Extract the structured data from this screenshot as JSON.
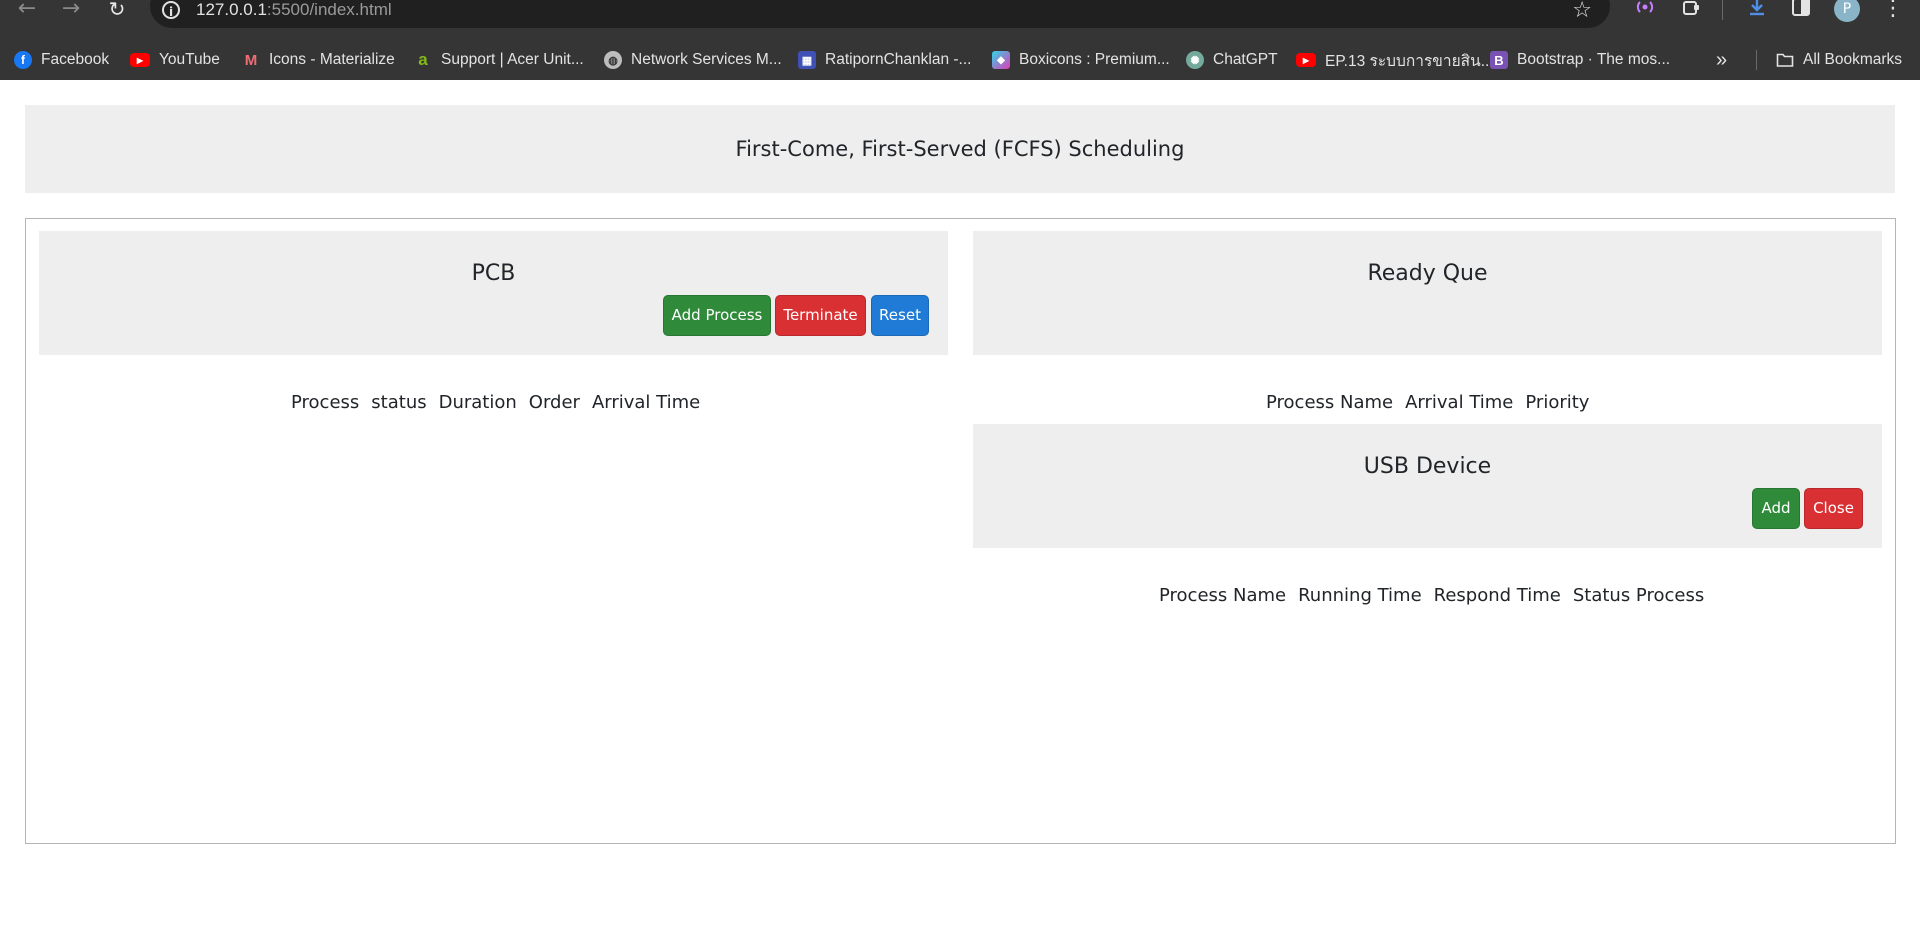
{
  "browser": {
    "url_host": "127.0.0.1",
    "url_rest": ":5500/index.html",
    "profile_initial": "P",
    "bookmarks": [
      {
        "label": "Facebook",
        "icon": "facebook-icon"
      },
      {
        "label": "YouTube",
        "icon": "youtube-icon"
      },
      {
        "label": "Icons - Materialize",
        "icon": "materialize-icon"
      },
      {
        "label": "Support | Acer Unit...",
        "icon": "acer-icon"
      },
      {
        "label": "Network Services M...",
        "icon": "globe-icon"
      },
      {
        "label": "RatipornChanklan -...",
        "icon": "site-icon"
      },
      {
        "label": "Boxicons : Premium...",
        "icon": "boxicons-icon"
      },
      {
        "label": "ChatGPT",
        "icon": "chatgpt-icon"
      },
      {
        "label": "EP.13 ระบบการขายสิน...",
        "icon": "youtube-icon"
      },
      {
        "label": "Bootstrap · The mos...",
        "icon": "bootstrap-icon"
      }
    ],
    "more_bookmarks": "»",
    "all_bookmarks": "All Bookmarks"
  },
  "page": {
    "title": "First-Come, First-Served (FCFS) Scheduling",
    "pcb": {
      "title": "PCB",
      "buttons": {
        "add": "Add Process",
        "terminate": "Terminate",
        "reset": "Reset"
      },
      "columns": [
        "Process",
        "status",
        "Duration",
        "Order",
        "Arrival Time"
      ]
    },
    "ready_queue": {
      "title": "Ready Que",
      "columns": [
        "Process Name",
        "Arrival Time",
        "Priority"
      ]
    },
    "usb": {
      "title": "USB Device",
      "buttons": {
        "add": "Add",
        "close": "Close"
      },
      "columns": [
        "Process Name",
        "Running Time",
        "Respond Time",
        "Status Process"
      ]
    }
  },
  "colors": {
    "success": "#2f8b3a",
    "danger": "#d93033",
    "primary": "#1f7bd6",
    "panel_bg": "#eeeeee"
  }
}
